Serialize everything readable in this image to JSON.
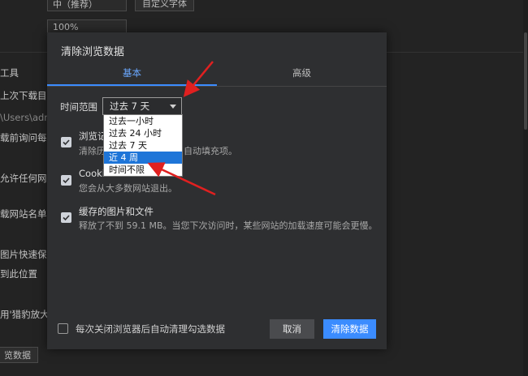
{
  "background": {
    "font_select": "中（推荐）",
    "custom_font_button": "自定义字体",
    "zoom_label": "",
    "zoom_select": "100%",
    "items": [
      {
        "text": "工具"
      },
      {
        "text": "上次下载目"
      },
      {
        "text": "\\Users\\adm"
      },
      {
        "text": "载前询问每个"
      },
      {
        "text": "允许任何网站"
      },
      {
        "text": "载网站名单"
      },
      {
        "text": "图片快速保"
      },
      {
        "text": "到此位置"
      },
      {
        "text": "用'猎豹放大镜"
      }
    ],
    "bottom_button": "览数据"
  },
  "dialog": {
    "title": "清除浏览数据",
    "tabs": [
      {
        "label": "基本",
        "active": true
      },
      {
        "label": "高级",
        "active": false
      }
    ],
    "time_range_label": "时间范围",
    "time_range_value": "过去 7 天",
    "options": [
      {
        "label": "过去一小时",
        "selected": false
      },
      {
        "label": "过去 24 小时",
        "selected": false
      },
      {
        "label": "过去 7 天",
        "selected": false
      },
      {
        "label": "近 4 周",
        "selected": true
      },
      {
        "label": "时间不限",
        "selected": false
      }
    ],
    "items": [
      {
        "title": "浏览记",
        "desc": "清除历",
        "desc_tail": "自动填充项。",
        "checked": true
      },
      {
        "title": "Cookie",
        "desc": "您会从大多数网站退出。",
        "checked": true
      },
      {
        "title": "缓存的图片和文件",
        "desc": "释放了不到 59.1 MB。当您下次访问时，某些网站的加载速度可能会更慢。",
        "checked": true
      }
    ],
    "footer_checkbox_label": "每次关闭浏览器后自动清理勾选数据",
    "footer_checked": false,
    "cancel_label": "取消",
    "clear_label": "清除数据"
  },
  "colors": {
    "accent": "#3b8cff",
    "annotation_arrow": "#e02020",
    "dropdown_selected": "#1e75d8"
  }
}
